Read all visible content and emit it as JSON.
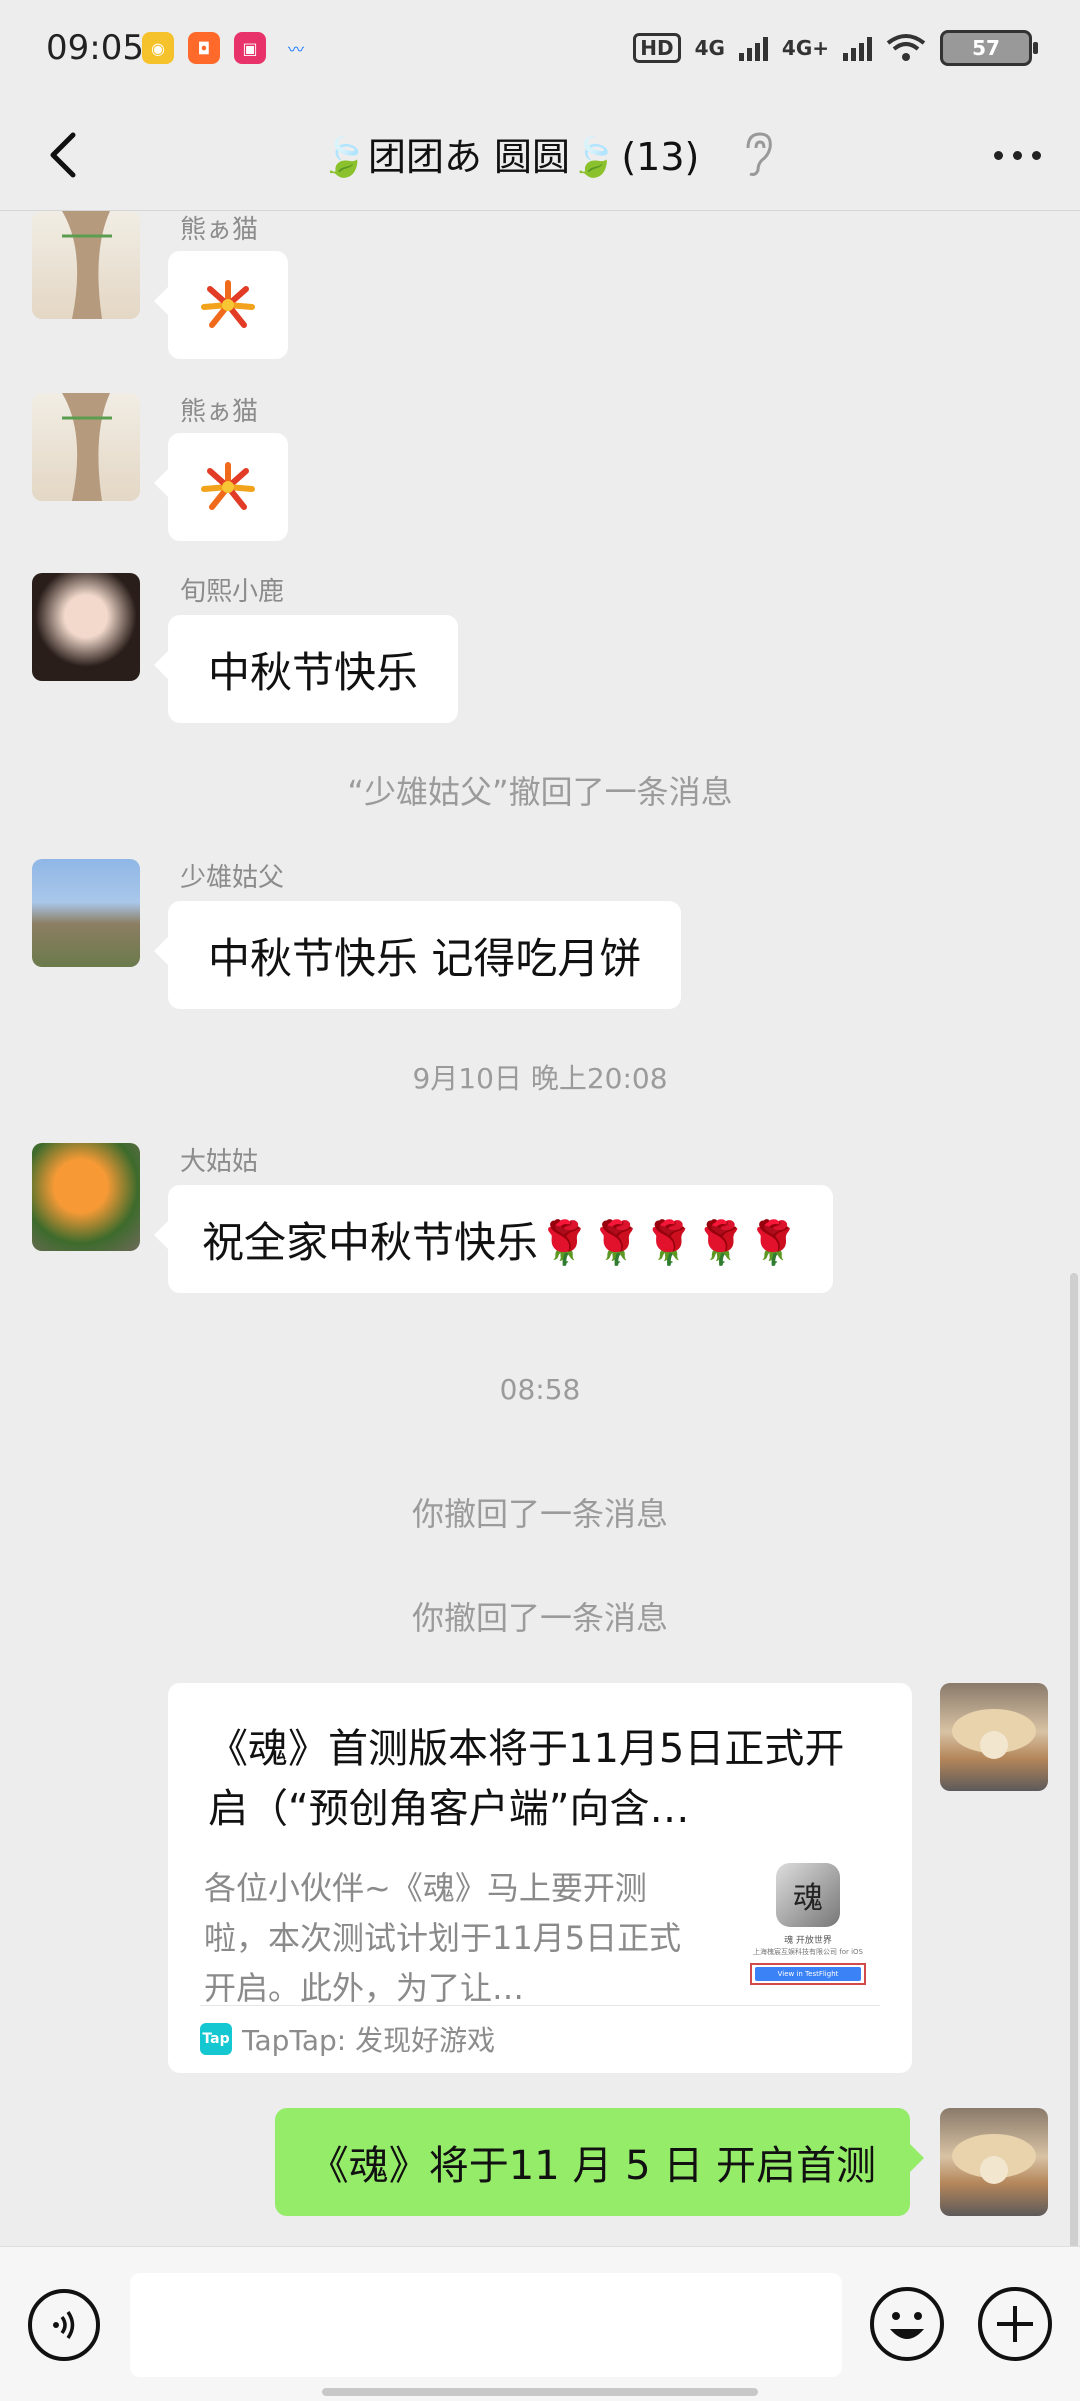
{
  "status_bar": {
    "time": "09:05",
    "network_1": "4G",
    "network_2": "4G+",
    "hd_label": "HD",
    "battery": "57",
    "apps": [
      "weibo-icon",
      "app-icon",
      "tv-icon",
      "cloud-icon"
    ]
  },
  "header": {
    "title": "🍃团团あ 圆圆🍃",
    "member_count": "(13)"
  },
  "messages": [
    {
      "sender": "熊ぁ猫",
      "type": "sticker"
    },
    {
      "sender": "熊ぁ猫",
      "type": "sticker"
    },
    {
      "sender": "旬熙小鹿",
      "text": "中秋节快乐"
    },
    {
      "system": "“少雄姑父”撤回了一条消息"
    },
    {
      "sender": "少雄姑父",
      "text": "中秋节快乐 记得吃月饼"
    },
    {
      "timestamp": "9月10日 晚上20:08"
    },
    {
      "sender": "大姑姑",
      "text": "祝全家中秋节快乐🌹🌹🌹🌹🌹"
    },
    {
      "timestamp": "08:58"
    },
    {
      "system": "你撤回了一条消息"
    },
    {
      "system": "你撤回了一条消息"
    }
  ],
  "link_card": {
    "title": "《魂》首测版本将于11月5日正式开启（“预创角客户端”向含…",
    "description": "各位小伙伴~《魂》马上要开测啦，本次测试计划于11月5日正式开启。此外，为了让…",
    "source": "TapTap: 发现好游戏",
    "source_icon": "Tap",
    "thumb_line1": "魂 开放世界",
    "thumb_line2": "上海槐宸互娱科技有限公司 for iOS",
    "thumb_button": "View in TestFlight"
  },
  "my_message": "《魂》将于11 月 5 日 开启首测",
  "colors": {
    "background": "#ededed",
    "bubble_self": "#95ec69",
    "bubble_other": "#ffffff",
    "tap_brand": "#14c7d1"
  }
}
